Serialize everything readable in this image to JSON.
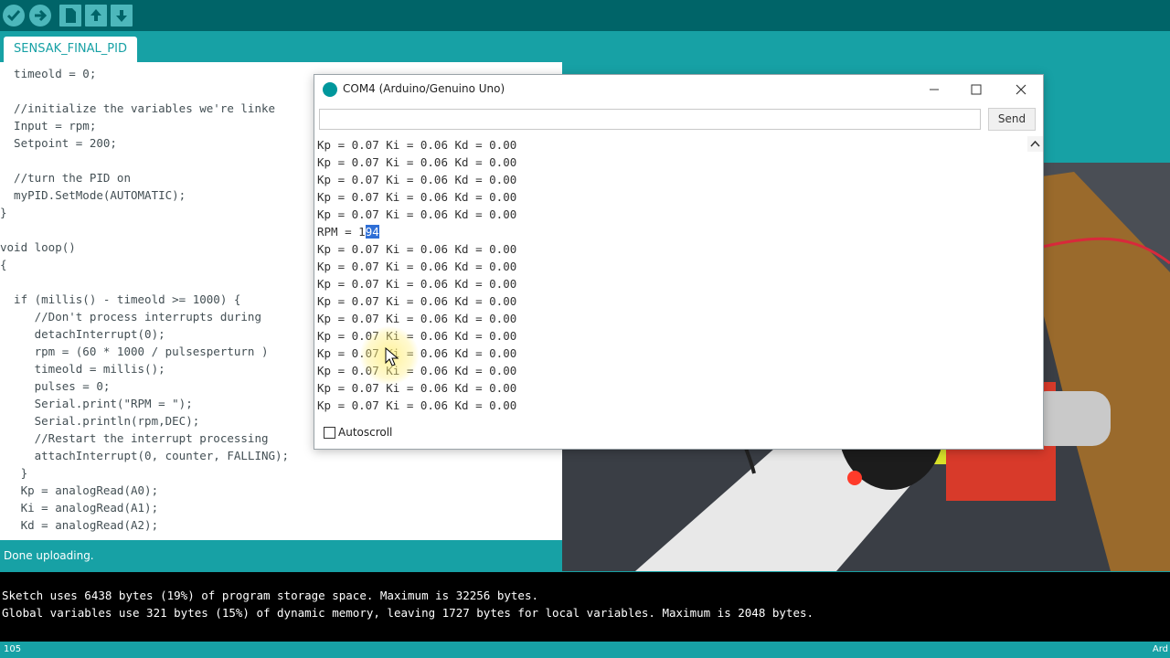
{
  "toolbar": {
    "buttons": [
      "verify-icon",
      "upload-icon",
      "new-icon",
      "open-icon",
      "save-icon"
    ]
  },
  "tab": {
    "label": "SENSAK_FINAL_PID"
  },
  "editor": {
    "lines": [
      "  timeold = 0;",
      "",
      "  //initialize the variables we're linke",
      "  Input = rpm;",
      "  Setpoint = 200;",
      "",
      "  //turn the PID on",
      "  myPID.SetMode(AUTOMATIC);",
      "}",
      "",
      "void loop()",
      "{",
      "",
      "  if (millis() - timeold >= 1000) {",
      "     //Don't process interrupts during",
      "     detachInterrupt(0);",
      "     rpm = (60 * 1000 / pulsesperturn )",
      "     timeold = millis();",
      "     pulses = 0;",
      "     Serial.print(\"RPM = \");",
      "     Serial.println(rpm,DEC);",
      "     //Restart the interrupt processing",
      "     attachInterrupt(0, counter, FALLING);",
      "   }",
      "   Kp = analogRead(A0);",
      "   Ki = analogRead(A1);",
      "   Kd = analogRead(A2);"
    ]
  },
  "status": {
    "text": "Done uploading."
  },
  "console": {
    "lines": [
      "Sketch uses 6438 bytes (19%) of program storage space. Maximum is 32256 bytes.",
      "Global variables use 321 bytes (15%) of dynamic memory, leaving 1727 bytes for local variables. Maximum is 2048 bytes."
    ]
  },
  "bottom": {
    "line_number": "105",
    "board": "Ard"
  },
  "serial_monitor": {
    "title": "COM4 (Arduino/Genuino Uno)",
    "input_value": "",
    "send_label": "Send",
    "autoscroll_label": "Autoscroll",
    "autoscroll_checked": false,
    "output": [
      "Kp = 0.07 Ki = 0.06 Kd = 0.00",
      "Kp = 0.07 Ki = 0.06 Kd = 0.00",
      "Kp = 0.07 Ki = 0.06 Kd = 0.00",
      "Kp = 0.07 Ki = 0.06 Kd = 0.00",
      "Kp = 0.07 Ki = 0.06 Kd = 0.00",
      "RPM = 194",
      "Kp = 0.07 Ki = 0.06 Kd = 0.00",
      "Kp = 0.07 Ki = 0.06 Kd = 0.00",
      "Kp = 0.07 Ki = 0.06 Kd = 0.00",
      "Kp = 0.07 Ki = 0.06 Kd = 0.00",
      "Kp = 0.07 Ki = 0.06 Kd = 0.00",
      "Kp = 0.07 Ki = 0.06 Kd = 0.00",
      "Kp = 0.07 Ki = 0.06 Kd = 0.00",
      "Kp = 0.07 Ki = 0.06 Kd = 0.00",
      "Kp = 0.07 Ki = 0.06 Kd = 0.00",
      "Kp = 0.07 Ki = 0.06 Kd = 0.00"
    ],
    "rpm_prefix": "RPM = 1",
    "rpm_selected": "94"
  },
  "colors": {
    "accent": "#17a1a5",
    "toolbar": "#006468",
    "selection": "#2f6fd6"
  }
}
